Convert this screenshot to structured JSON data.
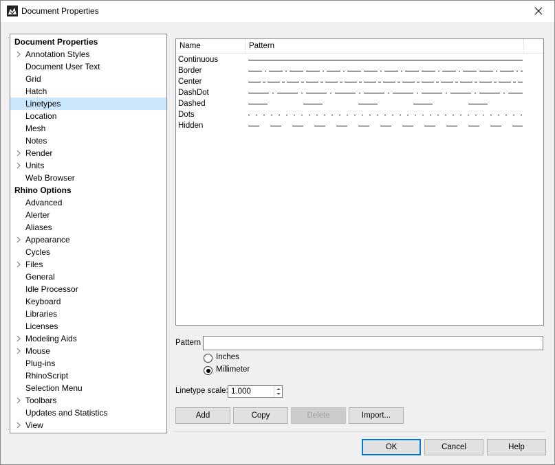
{
  "window": {
    "title": "Document Properties"
  },
  "tree": {
    "items": [
      {
        "label": "Document Properties",
        "root": true,
        "expandable": false
      },
      {
        "label": "Annotation Styles",
        "expandable": true
      },
      {
        "label": "Document User Text",
        "expandable": false
      },
      {
        "label": "Grid",
        "expandable": false
      },
      {
        "label": "Hatch",
        "expandable": false
      },
      {
        "label": "Linetypes",
        "expandable": false,
        "selected": true
      },
      {
        "label": "Location",
        "expandable": false
      },
      {
        "label": "Mesh",
        "expandable": false
      },
      {
        "label": "Notes",
        "expandable": false
      },
      {
        "label": "Render",
        "expandable": true
      },
      {
        "label": "Units",
        "expandable": true
      },
      {
        "label": "Web Browser",
        "expandable": false
      },
      {
        "label": "Rhino Options",
        "root": true,
        "expandable": false
      },
      {
        "label": "Advanced",
        "expandable": false
      },
      {
        "label": "Alerter",
        "expandable": false
      },
      {
        "label": "Aliases",
        "expandable": false
      },
      {
        "label": "Appearance",
        "expandable": true
      },
      {
        "label": "Cycles",
        "expandable": false
      },
      {
        "label": "Files",
        "expandable": true
      },
      {
        "label": "General",
        "expandable": false
      },
      {
        "label": "Idle Processor",
        "expandable": false
      },
      {
        "label": "Keyboard",
        "expandable": false
      },
      {
        "label": "Libraries",
        "expandable": false
      },
      {
        "label": "Licenses",
        "expandable": false
      },
      {
        "label": "Modeling Aids",
        "expandable": true
      },
      {
        "label": "Mouse",
        "expandable": true
      },
      {
        "label": "Plug-ins",
        "expandable": false
      },
      {
        "label": "RhinoScript",
        "expandable": false
      },
      {
        "label": "Selection Menu",
        "expandable": false
      },
      {
        "label": "Toolbars",
        "expandable": true
      },
      {
        "label": "Updates and Statistics",
        "expandable": false
      },
      {
        "label": "View",
        "expandable": true
      }
    ]
  },
  "linetypes": {
    "columns": [
      "Name",
      "Pattern"
    ],
    "rows": [
      {
        "name": "Continuous",
        "pattern": "continuous"
      },
      {
        "name": "Border",
        "pattern": "border"
      },
      {
        "name": "Center",
        "pattern": "center"
      },
      {
        "name": "DashDot",
        "pattern": "dashdot"
      },
      {
        "name": "Dashed",
        "pattern": "dashed"
      },
      {
        "name": "Dots",
        "pattern": "dots"
      },
      {
        "name": "Hidden",
        "pattern": "hidden"
      }
    ]
  },
  "pattern": {
    "label": "Pattern",
    "value": ""
  },
  "units": {
    "inches_label": "Inches",
    "millimeter_label": "Millimeter",
    "selected": "Millimeter"
  },
  "scale": {
    "label": "Linetype scale:",
    "value": "1.000"
  },
  "actions": {
    "add": "Add",
    "copy": "Copy",
    "delete": "Delete",
    "import": "Import..."
  },
  "dialog": {
    "ok": "OK",
    "cancel": "Cancel",
    "help": "Help"
  }
}
